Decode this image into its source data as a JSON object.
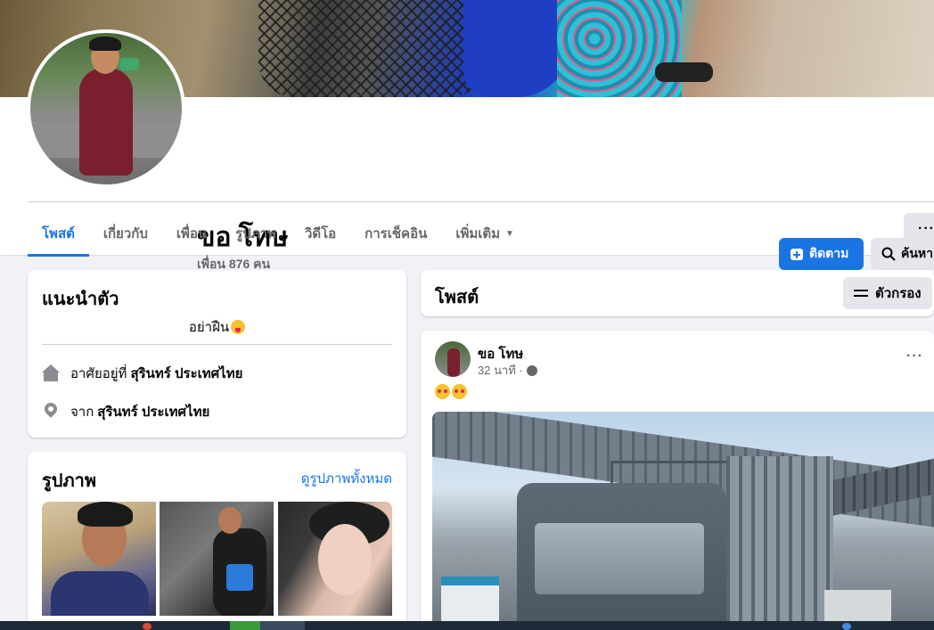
{
  "profile": {
    "name": "ขอ โทษ",
    "friends_text": "เพื่อน 876 คน"
  },
  "actions": {
    "follow_label": "ติดตาม",
    "search_label": "ค้นหา",
    "more_label": "···"
  },
  "tabs": [
    {
      "label": "โพสต์",
      "active": true
    },
    {
      "label": "เกี่ยวกับ"
    },
    {
      "label": "เพื่อน"
    },
    {
      "label": "รูปภาพ"
    },
    {
      "label": "วิดีโอ"
    },
    {
      "label": "การเช็คอิน"
    },
    {
      "label": "เพิ่มเติม"
    }
  ],
  "intro": {
    "title": "แนะนำตัว",
    "bio": "อย่าฝืน",
    "lives_in_prefix": "อาศัยอยู่ที่",
    "lives_in_value": "สุรินทร์ ประเทศไทย",
    "from_prefix": "จาก",
    "from_value": "สุรินทร์ ประเทศไทย"
  },
  "photos": {
    "title": "รูปภาพ",
    "see_all": "ดูรูปภาพทั้งหมด"
  },
  "posts_header": {
    "title": "โพสต์",
    "filter_label": "ตัวกรอง"
  },
  "post": {
    "author": "ขอ โทษ",
    "time": "32 นาที ·",
    "more": "···"
  },
  "colors": {
    "accent": "#1b74e4",
    "background": "#f0f2f5",
    "card": "#ffffff",
    "secondary_text": "#65676b"
  },
  "icons": [
    "add-friend-icon",
    "search-icon",
    "home-icon",
    "location-pin-icon",
    "filter-icon",
    "globe-icon",
    "more-dots-icon",
    "caret-down-icon"
  ]
}
